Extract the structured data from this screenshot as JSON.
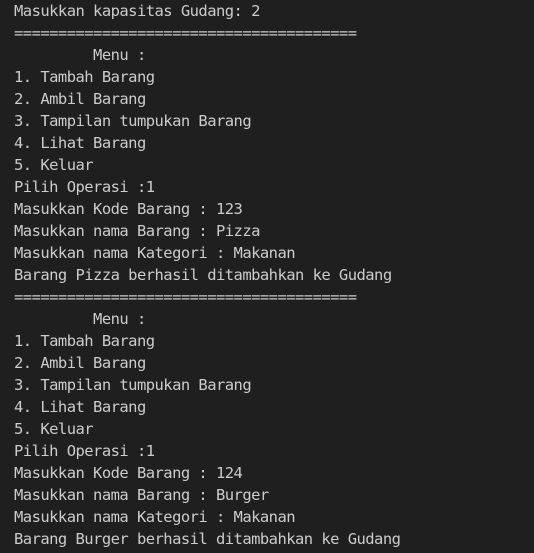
{
  "terminal": {
    "lines": [
      "Masukkan kapasitas Gudang: 2",
      "=======================================",
      "         Menu :",
      "1. Tambah Barang",
      "2. Ambil Barang",
      "3. Tampilan tumpukan Barang",
      "4. Lihat Barang",
      "5. Keluar",
      "Pilih Operasi :1",
      "Masukkan Kode Barang : 123",
      "Masukkan nama Barang : Pizza",
      "Masukkan nama Kategori : Makanan",
      "Barang Pizza berhasil ditambahkan ke Gudang",
      "=======================================",
      "         Menu :",
      "1. Tambah Barang",
      "2. Ambil Barang",
      "3. Tampilan tumpukan Barang",
      "4. Lihat Barang",
      "5. Keluar",
      "Pilih Operasi :1",
      "Masukkan Kode Barang : 124",
      "Masukkan nama Barang : Burger",
      "Masukkan nama Kategori : Makanan",
      "Barang Burger berhasil ditambahkan ke Gudang"
    ]
  },
  "colors": {
    "background": "#1f1f1f",
    "text": "#cccccc"
  }
}
